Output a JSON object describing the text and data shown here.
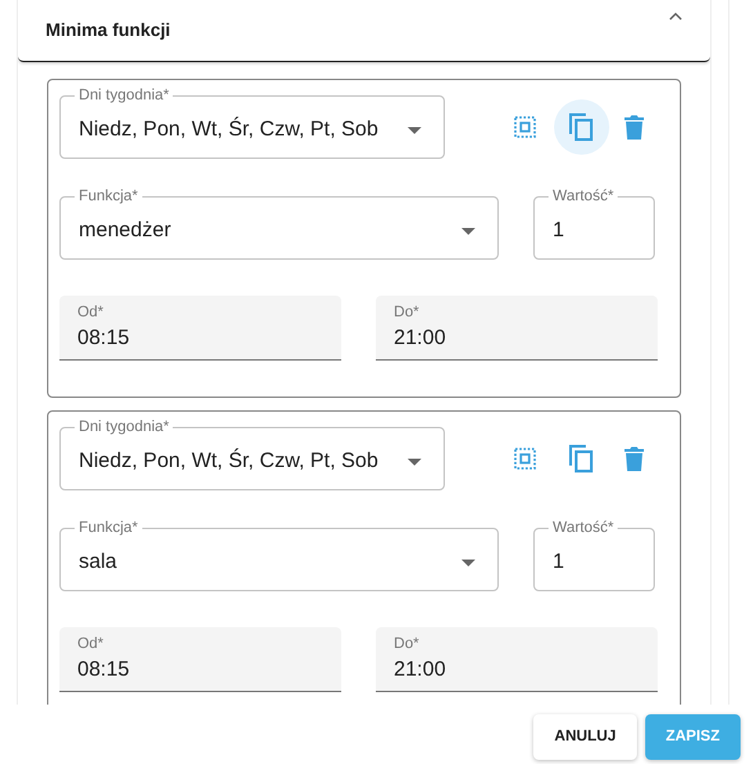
{
  "section": {
    "title": "Minima funkcji",
    "expanded": true
  },
  "rules": [
    {
      "days": {
        "label": "Dni tygodnia*",
        "value": "Niedz, Pon, Wt, Śr, Czw, Pt, Sob"
      },
      "copy_hovered": true,
      "function": {
        "label": "Funkcja*",
        "value": "menedżer"
      },
      "amount": {
        "label": "Wartość*",
        "value": "1"
      },
      "from": {
        "label": "Od*",
        "value": "08:15"
      },
      "to": {
        "label": "Do*",
        "value": "21:00"
      }
    },
    {
      "days": {
        "label": "Dni tygodnia*",
        "value": "Niedz, Pon, Wt, Śr, Czw, Pt, Sob"
      },
      "copy_hovered": false,
      "function": {
        "label": "Funkcja*",
        "value": "sala"
      },
      "amount": {
        "label": "Wartość*",
        "value": "1"
      },
      "from": {
        "label": "Od*",
        "value": "08:15"
      },
      "to": {
        "label": "Do*",
        "value": "21:00"
      }
    }
  ],
  "buttons": [
    {
      "label": "ANULUJ",
      "kind": "secondary"
    },
    {
      "label": "ZAPISZ",
      "kind": "primary"
    }
  ]
}
